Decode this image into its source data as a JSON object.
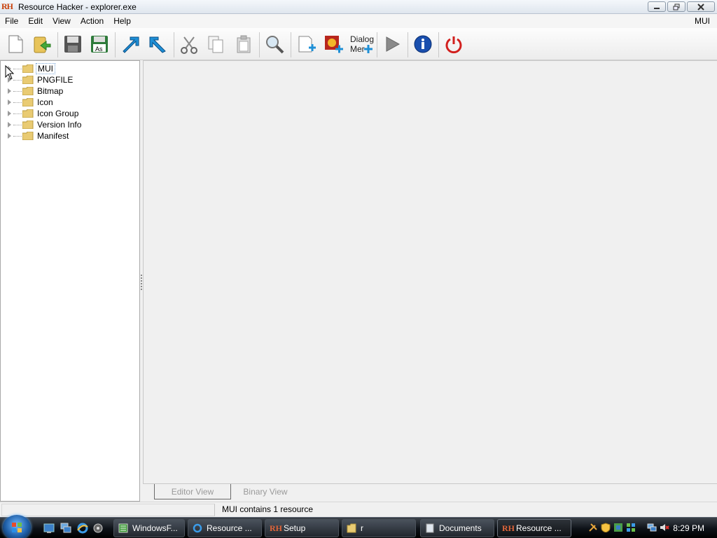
{
  "window": {
    "app_icon_text": "RH",
    "title": "Resource Hacker - explorer.exe"
  },
  "menubar": {
    "items": [
      "File",
      "Edit",
      "View",
      "Action",
      "Help"
    ],
    "right_label": "MUI"
  },
  "toolbar": {
    "buttons": [
      {
        "name": "new-file-icon"
      },
      {
        "name": "open-file-icon"
      },
      {
        "name": "save-icon"
      },
      {
        "name": "save-as-icon",
        "label": "As"
      },
      {
        "name": "compile-up-icon"
      },
      {
        "name": "compile-down-icon"
      },
      {
        "name": "cut-icon"
      },
      {
        "name": "copy-icon"
      },
      {
        "name": "paste-icon"
      },
      {
        "name": "find-icon"
      },
      {
        "name": "add-resource-icon"
      },
      {
        "name": "add-image-icon"
      },
      {
        "name": "dialog-menu-icon",
        "label_top": "Dialog",
        "label_bottom": "Mer"
      },
      {
        "name": "run-script-icon"
      },
      {
        "name": "info-icon"
      },
      {
        "name": "exit-icon"
      }
    ]
  },
  "tree": {
    "items": [
      "MUI",
      "PNGFILE",
      "Bitmap",
      "Icon",
      "Icon Group",
      "Version Info",
      "Manifest"
    ],
    "selected": "MUI"
  },
  "tabs": {
    "editor_view": "Editor View",
    "binary_view": "Binary View"
  },
  "statusbar": {
    "text": "MUI contains 1 resource"
  },
  "taskbar": {
    "tasks": [
      "WindowsF...",
      "Resource ...",
      "Setup",
      "r",
      "Documents",
      "Resource ..."
    ],
    "task_icon_rh": "RH",
    "clock": "8:29 PM"
  },
  "colors": {
    "accent_rh": "#c8400a",
    "tab_text": "#9a9a9a",
    "taskbar_bg": "#0d1117"
  }
}
